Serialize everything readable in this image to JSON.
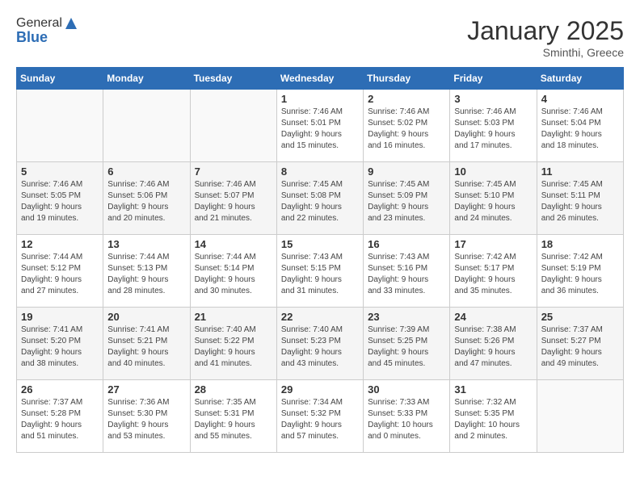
{
  "header": {
    "logo_line1": "General",
    "logo_line2": "Blue",
    "month": "January 2025",
    "location": "Sminthi, Greece"
  },
  "weekdays": [
    "Sunday",
    "Monday",
    "Tuesday",
    "Wednesday",
    "Thursday",
    "Friday",
    "Saturday"
  ],
  "weeks": [
    [
      {
        "day": "",
        "info": ""
      },
      {
        "day": "",
        "info": ""
      },
      {
        "day": "",
        "info": ""
      },
      {
        "day": "1",
        "info": "Sunrise: 7:46 AM\nSunset: 5:01 PM\nDaylight: 9 hours\nand 15 minutes."
      },
      {
        "day": "2",
        "info": "Sunrise: 7:46 AM\nSunset: 5:02 PM\nDaylight: 9 hours\nand 16 minutes."
      },
      {
        "day": "3",
        "info": "Sunrise: 7:46 AM\nSunset: 5:03 PM\nDaylight: 9 hours\nand 17 minutes."
      },
      {
        "day": "4",
        "info": "Sunrise: 7:46 AM\nSunset: 5:04 PM\nDaylight: 9 hours\nand 18 minutes."
      }
    ],
    [
      {
        "day": "5",
        "info": "Sunrise: 7:46 AM\nSunset: 5:05 PM\nDaylight: 9 hours\nand 19 minutes."
      },
      {
        "day": "6",
        "info": "Sunrise: 7:46 AM\nSunset: 5:06 PM\nDaylight: 9 hours\nand 20 minutes."
      },
      {
        "day": "7",
        "info": "Sunrise: 7:46 AM\nSunset: 5:07 PM\nDaylight: 9 hours\nand 21 minutes."
      },
      {
        "day": "8",
        "info": "Sunrise: 7:45 AM\nSunset: 5:08 PM\nDaylight: 9 hours\nand 22 minutes."
      },
      {
        "day": "9",
        "info": "Sunrise: 7:45 AM\nSunset: 5:09 PM\nDaylight: 9 hours\nand 23 minutes."
      },
      {
        "day": "10",
        "info": "Sunrise: 7:45 AM\nSunset: 5:10 PM\nDaylight: 9 hours\nand 24 minutes."
      },
      {
        "day": "11",
        "info": "Sunrise: 7:45 AM\nSunset: 5:11 PM\nDaylight: 9 hours\nand 26 minutes."
      }
    ],
    [
      {
        "day": "12",
        "info": "Sunrise: 7:44 AM\nSunset: 5:12 PM\nDaylight: 9 hours\nand 27 minutes."
      },
      {
        "day": "13",
        "info": "Sunrise: 7:44 AM\nSunset: 5:13 PM\nDaylight: 9 hours\nand 28 minutes."
      },
      {
        "day": "14",
        "info": "Sunrise: 7:44 AM\nSunset: 5:14 PM\nDaylight: 9 hours\nand 30 minutes."
      },
      {
        "day": "15",
        "info": "Sunrise: 7:43 AM\nSunset: 5:15 PM\nDaylight: 9 hours\nand 31 minutes."
      },
      {
        "day": "16",
        "info": "Sunrise: 7:43 AM\nSunset: 5:16 PM\nDaylight: 9 hours\nand 33 minutes."
      },
      {
        "day": "17",
        "info": "Sunrise: 7:42 AM\nSunset: 5:17 PM\nDaylight: 9 hours\nand 35 minutes."
      },
      {
        "day": "18",
        "info": "Sunrise: 7:42 AM\nSunset: 5:19 PM\nDaylight: 9 hours\nand 36 minutes."
      }
    ],
    [
      {
        "day": "19",
        "info": "Sunrise: 7:41 AM\nSunset: 5:20 PM\nDaylight: 9 hours\nand 38 minutes."
      },
      {
        "day": "20",
        "info": "Sunrise: 7:41 AM\nSunset: 5:21 PM\nDaylight: 9 hours\nand 40 minutes."
      },
      {
        "day": "21",
        "info": "Sunrise: 7:40 AM\nSunset: 5:22 PM\nDaylight: 9 hours\nand 41 minutes."
      },
      {
        "day": "22",
        "info": "Sunrise: 7:40 AM\nSunset: 5:23 PM\nDaylight: 9 hours\nand 43 minutes."
      },
      {
        "day": "23",
        "info": "Sunrise: 7:39 AM\nSunset: 5:25 PM\nDaylight: 9 hours\nand 45 minutes."
      },
      {
        "day": "24",
        "info": "Sunrise: 7:38 AM\nSunset: 5:26 PM\nDaylight: 9 hours\nand 47 minutes."
      },
      {
        "day": "25",
        "info": "Sunrise: 7:37 AM\nSunset: 5:27 PM\nDaylight: 9 hours\nand 49 minutes."
      }
    ],
    [
      {
        "day": "26",
        "info": "Sunrise: 7:37 AM\nSunset: 5:28 PM\nDaylight: 9 hours\nand 51 minutes."
      },
      {
        "day": "27",
        "info": "Sunrise: 7:36 AM\nSunset: 5:30 PM\nDaylight: 9 hours\nand 53 minutes."
      },
      {
        "day": "28",
        "info": "Sunrise: 7:35 AM\nSunset: 5:31 PM\nDaylight: 9 hours\nand 55 minutes."
      },
      {
        "day": "29",
        "info": "Sunrise: 7:34 AM\nSunset: 5:32 PM\nDaylight: 9 hours\nand 57 minutes."
      },
      {
        "day": "30",
        "info": "Sunrise: 7:33 AM\nSunset: 5:33 PM\nDaylight: 10 hours\nand 0 minutes."
      },
      {
        "day": "31",
        "info": "Sunrise: 7:32 AM\nSunset: 5:35 PM\nDaylight: 10 hours\nand 2 minutes."
      },
      {
        "day": "",
        "info": ""
      }
    ]
  ]
}
